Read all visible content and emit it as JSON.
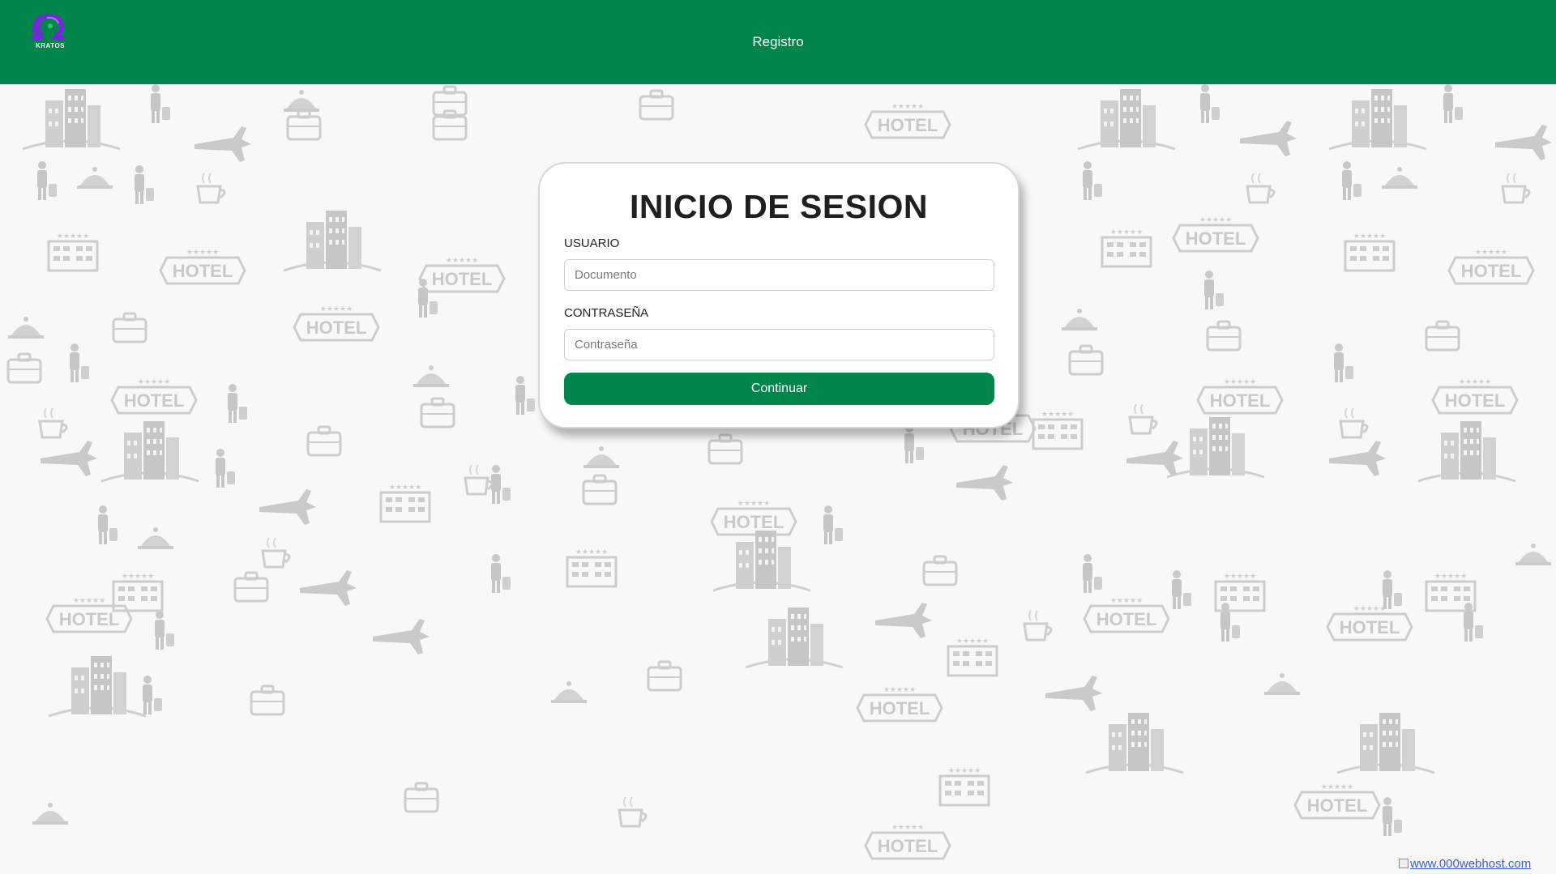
{
  "header": {
    "logo": {
      "icon": "omega-logo-icon",
      "text": "KRATOS",
      "colors": [
        "#6f2bd4",
        "#7b3fe4"
      ]
    },
    "nav_link": "Registro"
  },
  "background": {
    "icon_names": [
      "hotel-building-icon",
      "airplane-icon",
      "suitcase-icon",
      "hotel-sign-icon",
      "bell-icon",
      "coffee-cup-icon",
      "traveler-icon",
      "bellhop-icon"
    ],
    "sign_text": "HOTEL"
  },
  "login": {
    "title": "INICIO DE SESION",
    "user_label": "USUARIO",
    "user_placeholder": "Documento",
    "user_value": "",
    "password_label": "CONTRASEÑA",
    "password_placeholder": "Contraseña",
    "password_value": "",
    "submit_label": "Continuar"
  },
  "footer": {
    "host_link": "www.000webhost.com"
  },
  "colors": {
    "primary": "#00864a",
    "card_bg": "#ffffff",
    "page_bg": "#f8f8f8"
  }
}
